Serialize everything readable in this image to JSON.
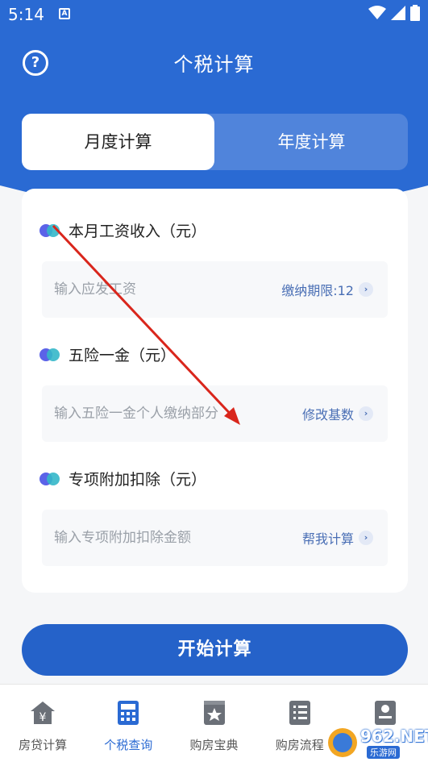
{
  "status_bar": {
    "time": "5:14",
    "notif_glyph": "A"
  },
  "header": {
    "title": "个税计算",
    "help_icon": "question-icon"
  },
  "tabs": [
    {
      "label": "月度计算",
      "active": true
    },
    {
      "label": "年度计算",
      "active": false
    }
  ],
  "sections": [
    {
      "label": "本月工资收入（元）",
      "placeholder": "输入应发工资",
      "action": "缴纳期限:12"
    },
    {
      "label": "五险一金（元）",
      "placeholder": "输入五险一金个人缴纳部分",
      "action": "修改基数"
    },
    {
      "label": "专项附加扣除（元）",
      "placeholder": "输入专项附加扣除金额",
      "action": "帮我计算"
    }
  ],
  "start_button": "开始计算",
  "nav": [
    {
      "label": "房贷计算",
      "icon": "house-yen-icon",
      "active": false
    },
    {
      "label": "个税查询",
      "icon": "calculator-icon",
      "active": true
    },
    {
      "label": "购房宝典",
      "icon": "book-star-icon",
      "active": false
    },
    {
      "label": "购房流程",
      "icon": "checklist-icon",
      "active": false
    },
    {
      "label": "",
      "icon": "profile-card-icon",
      "active": false
    }
  ],
  "watermark": {
    "main": "962.NET",
    "sub": "乐游网"
  },
  "colors": {
    "primary": "#2a6ad3",
    "button": "#2562c9",
    "annotation_arrow": "#d9261c"
  }
}
